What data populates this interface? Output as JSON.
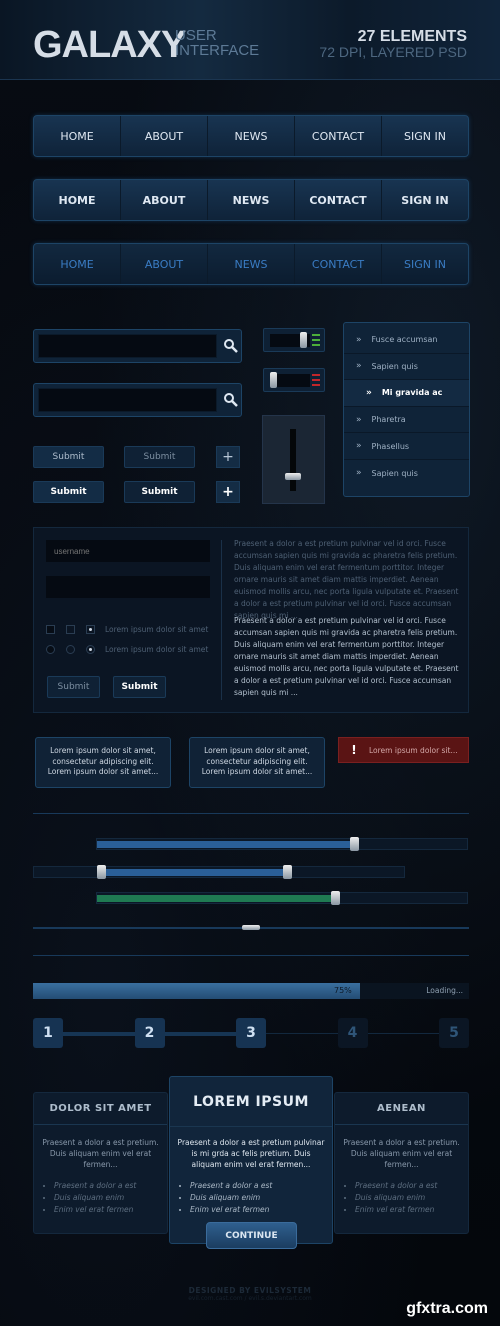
{
  "header": {
    "title": "GALAXY",
    "subtitle_line1": "USER",
    "subtitle_line2": "INTERFACE",
    "elements_count": "27 ELEMENTS",
    "format": "72 DPI, LAYERED PSD"
  },
  "navs": [
    {
      "style": "normal",
      "items": [
        "HOME",
        "ABOUT",
        "NEWS",
        "CONTACT",
        "SIGN IN"
      ]
    },
    {
      "style": "bold",
      "items": [
        "HOME",
        "ABOUT",
        "NEWS",
        "CONTACT",
        "SIGN IN"
      ]
    },
    {
      "style": "blue",
      "items": [
        "HOME",
        "ABOUT",
        "NEWS",
        "CONTACT",
        "SIGN IN"
      ]
    }
  ],
  "search": {
    "placeholder": "",
    "icon": "search-icon"
  },
  "buttons": {
    "submit": "Submit",
    "plus": "+"
  },
  "toggles": [
    {
      "state": "on",
      "led_color": "#4caf3a"
    },
    {
      "state": "off",
      "led_color": "#c0262a"
    }
  ],
  "vertical_slider": {
    "value": 0.3
  },
  "menu": {
    "items": [
      {
        "label": "Fusce accumsan",
        "active": false
      },
      {
        "label": "Sapien quis",
        "active": false
      },
      {
        "label": "Mi gravida ac",
        "active": true
      },
      {
        "label": "Pharetra",
        "active": false
      },
      {
        "label": "Phasellus",
        "active": false
      },
      {
        "label": "Sapien quis",
        "active": false
      }
    ]
  },
  "form": {
    "username_placeholder": "username",
    "password_placeholder": "",
    "checkbox_label": "Lorem ipsum dolor sit amet",
    "radio_label": "Lorem ipsum dolor sit amet",
    "submit_dim": "Submit",
    "submit_bold": "Submit",
    "text_dim": "Praesent a dolor a est pretium pulvinar vel id orci. Fusce accumsan sapien quis mi gravida ac pharetra felis pretium. Duis aliquam enim vel erat fermentum porttitor. Integer ornare mauris sit amet diam mattis imperdiet. Aenean euismod mollis arcu, nec porta ligula vulputate et. Praesent a dolor a est pretium pulvinar vel id orci. Fusce accumsan sapien quis mi ...",
    "text_bright": "Praesent a dolor a est pretium pulvinar vel id orci. Fusce accumsan sapien quis mi gravida ac pharetra felis pretium. Duis aliquam enim vel erat fermentum porttitor. Integer ornare mauris sit amet diam mattis imperdiet. Aenean euismod mollis arcu, nec porta ligula vulputate et. Praesent a dolor a est pretium pulvinar vel id orci. Fusce accumsan sapien quis mi ..."
  },
  "tooltips": [
    "Lorem ipsum dolor sit amet, consectetur adipiscing elit. Lorem ipsum dolor sit amet...",
    "Lorem ipsum dolor sit amet, consectetur adipiscing elit. Lorem ipsum dolor sit amet..."
  ],
  "alert": {
    "icon": "!",
    "text": "Lorem ipsum dolor sit..."
  },
  "sliders": [
    {
      "type": "single",
      "color": "#2a5f98",
      "value": 0.69
    },
    {
      "type": "range",
      "color": "#2a5f98",
      "low": 0.18,
      "high": 0.68
    },
    {
      "type": "single",
      "color": "#1f7a52",
      "value": 0.64
    },
    {
      "type": "single",
      "color": "#18395a",
      "value": 0.5
    }
  ],
  "progress": {
    "value": 0.75,
    "label": "75%",
    "status": "Loading..."
  },
  "steps": {
    "items": [
      "1",
      "2",
      "3",
      "4",
      "5"
    ],
    "current": 3
  },
  "pricing": {
    "left": {
      "title": "DOLOR SIT AMET",
      "desc": "Praesent a dolor a est pretium. Duis aliquam enim vel erat fermen...",
      "features": [
        "Praesent a dolor a est",
        "Duis aliquam enim",
        "Enim vel erat fermen"
      ]
    },
    "center": {
      "title": "LOREM IPSUM",
      "desc": "Praesent a dolor a est pretium pulvinar is mi grda ac felis pretium. Duis aliquam enim vel erat fermen...",
      "features": [
        "Praesent a dolor a est",
        "Duis aliquam enim",
        "Enim vel erat fermen"
      ],
      "button": "CONTINUE"
    },
    "right": {
      "title": "AENEAN",
      "desc": "Praesent a dolor a est pretium. Duis aliquam enim vel erat fermen...",
      "features": [
        "Praesent a dolor a est",
        "Duis aliquam enim",
        "Enim vel erat fermen"
      ]
    }
  },
  "footer": {
    "credit": "DESIGNED BY EVILSYSTEM",
    "links": "evil.com.cast.com / evil.s.deviantart.com"
  },
  "watermark": "gfxtra.com",
  "colors": {
    "accent": "#1d4466",
    "alert": "#5a1414",
    "progress": "#3a6f9f"
  }
}
